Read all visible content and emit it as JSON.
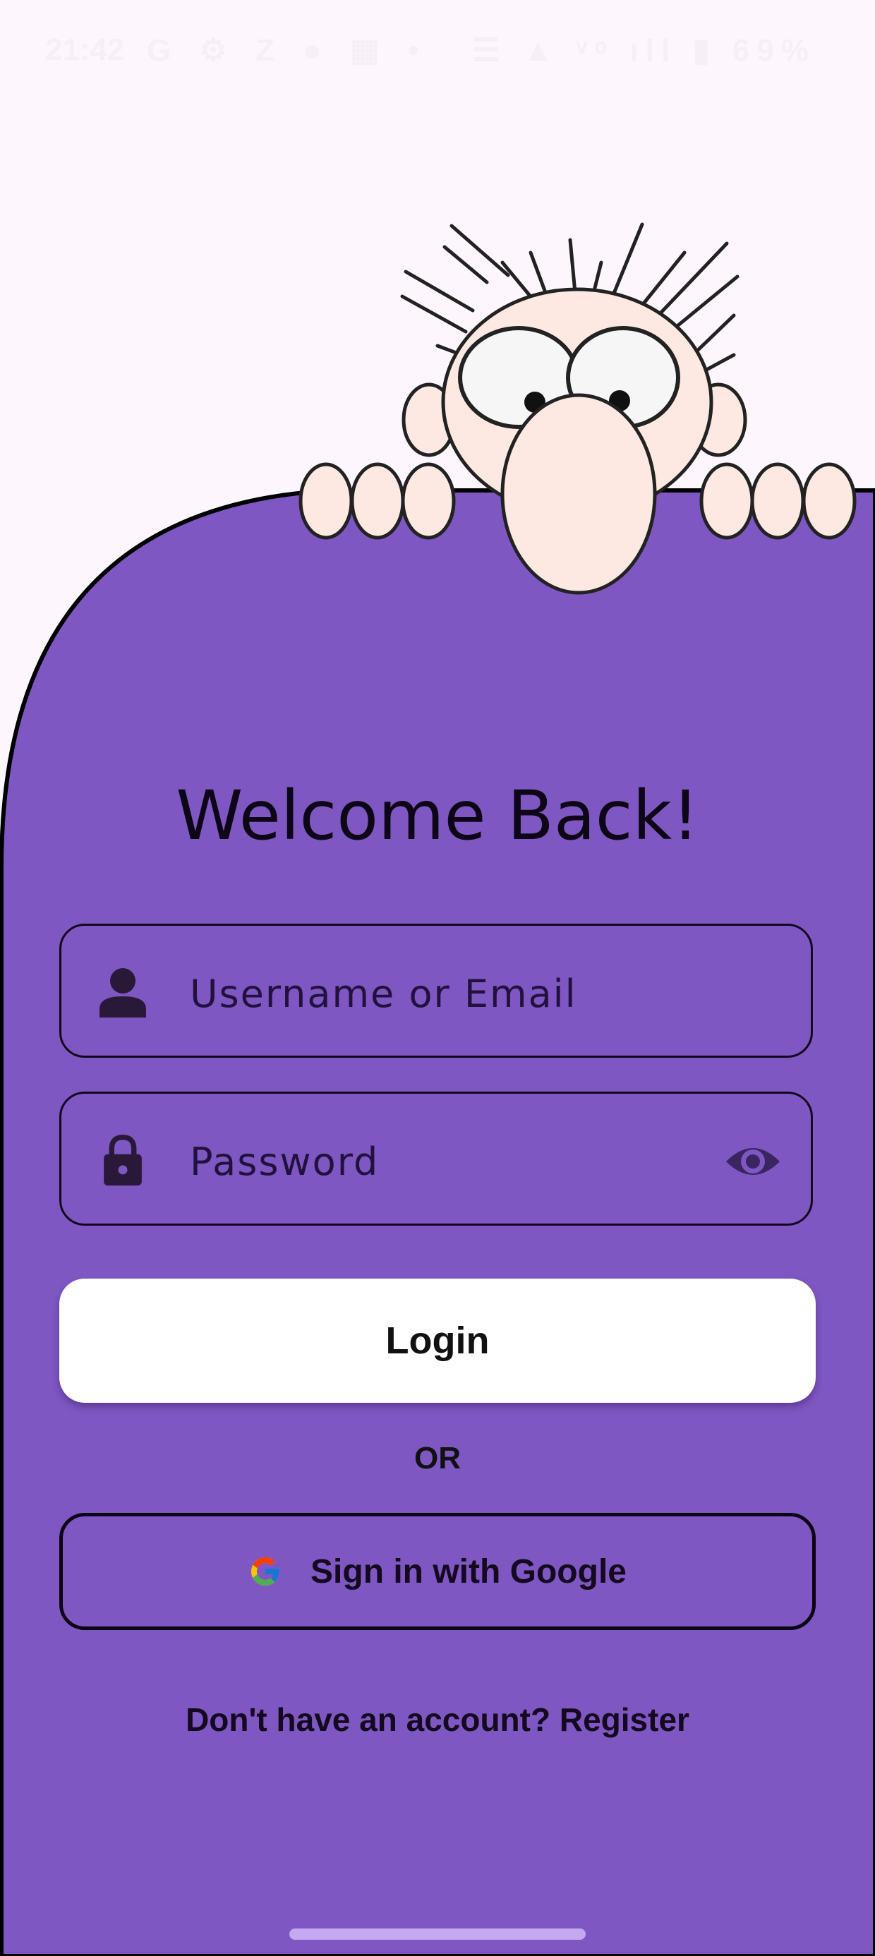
{
  "status_bar": {
    "time": "21:42",
    "left_icons": "G ⚙ Z ● ▦ •",
    "right_icons": "☰ ▲ ᵛᵒ ıll ▮ 69%"
  },
  "login": {
    "title": "Welcome Back!",
    "username_placeholder": "Username or Email",
    "password_placeholder": "Password",
    "login_label": "Login",
    "or_label": "OR",
    "google_label": "Sign in with Google",
    "register_prompt": "Don't have an account? ",
    "register_link": "Register"
  },
  "icons": {
    "username": "person-icon",
    "password": "lock-icon",
    "visibility": "eye-icon",
    "google": "google-icon"
  },
  "colors": {
    "panel": "#7e57c2",
    "background": "#fdf7fd",
    "button": "#ffffff"
  }
}
